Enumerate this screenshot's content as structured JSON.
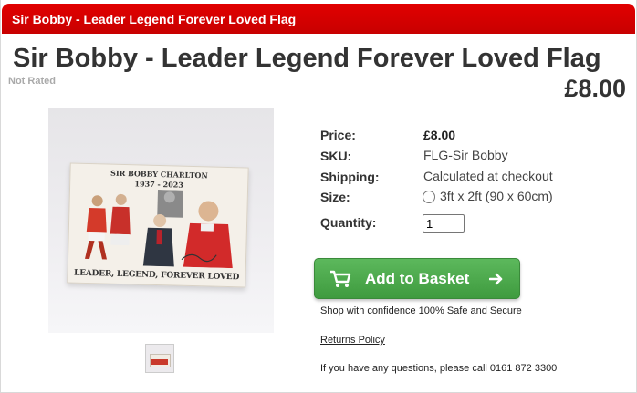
{
  "header": {
    "bar_title": "Sir Bobby - Leader Legend Forever Loved Flag"
  },
  "product": {
    "title": "Sir Bobby - Leader Legend Forever Loved Flag",
    "rating": "Not Rated",
    "price": "£8.00",
    "flag_text": {
      "name": "SIR BOBBY CHARLTON",
      "dates": "1937 - 2023",
      "motto": "LEADER, LEGEND, FOREVER LOVED"
    }
  },
  "specs": {
    "price_label": "Price:",
    "price_value": "£8.00",
    "sku_label": "SKU:",
    "sku_value": "FLG-Sir Bobby",
    "shipping_label": "Shipping:",
    "shipping_value": "Calculated at checkout",
    "size_label": "Size:",
    "size_option": "3ft x 2ft (90 x 60cm)",
    "quantity_label": "Quantity:",
    "quantity_value": "1"
  },
  "actions": {
    "add_to_basket": "Add to Basket"
  },
  "info": {
    "confidence": "Shop with confidence 100% Safe and Secure",
    "returns": "Returns Policy",
    "contact": "If you have any questions, please call 0161 872 3300"
  },
  "colors": {
    "brand_red": "#d40000",
    "button_green": "#4caf50"
  }
}
